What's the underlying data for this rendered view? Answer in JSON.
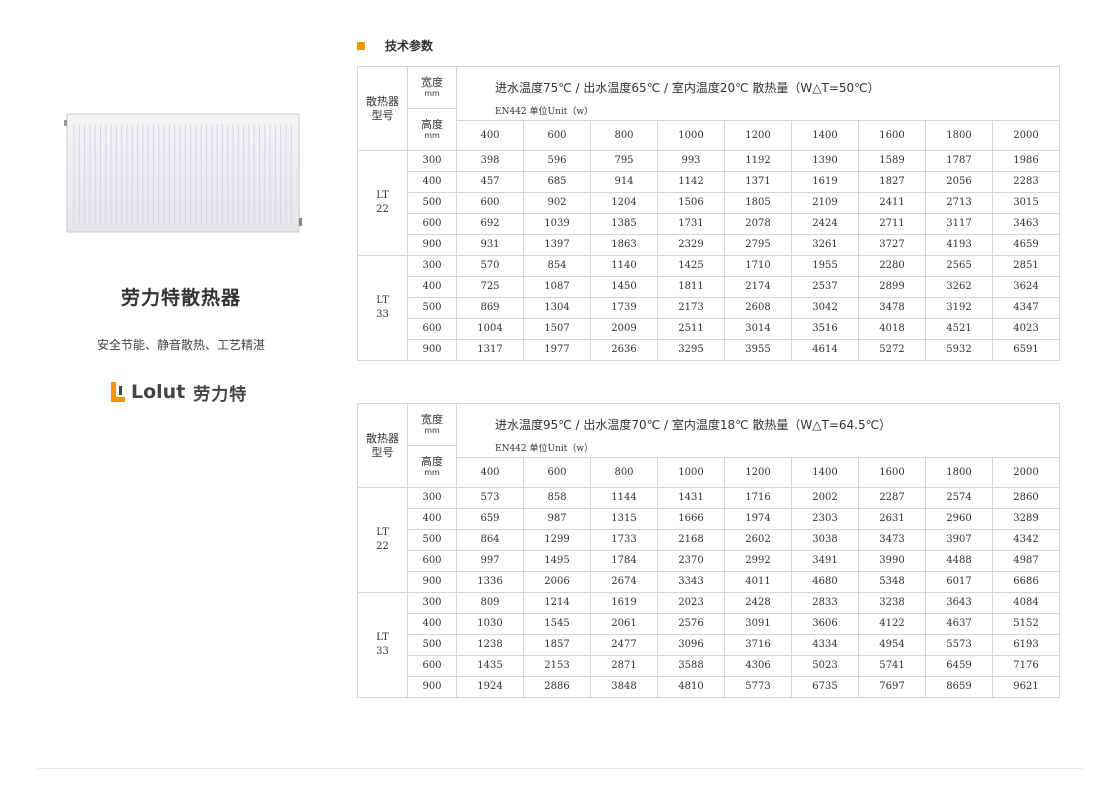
{
  "product": {
    "title": "劳力特散热器",
    "slogan": "安全节能、静音散热、工艺精湛",
    "brand_en": "Lolut",
    "brand_cn": "劳力特"
  },
  "section": {
    "title": "技术参数"
  },
  "table_header": {
    "model_label": "散热器型号",
    "width_label": "宽度",
    "height_label": "高度",
    "unit_label": "mm",
    "standard": "EN442   单位Unit（w）"
  },
  "widths": [
    "400",
    "600",
    "800",
    "1000",
    "1200",
    "1400",
    "1600",
    "1800",
    "2000"
  ],
  "tables": [
    {
      "condition": "进水温度75℃ / 出水温度65℃ / 室内温度20℃ 散热量（W△T=50℃）",
      "groups": [
        {
          "model": "LT\n22",
          "rows": [
            {
              "height": "300",
              "values": [
                "398",
                "596",
                "795",
                "993",
                "1192",
                "1390",
                "1589",
                "1787",
                "1986"
              ]
            },
            {
              "height": "400",
              "values": [
                "457",
                "685",
                "914",
                "1142",
                "1371",
                "1619",
                "1827",
                "2056",
                "2283"
              ]
            },
            {
              "height": "500",
              "values": [
                "600",
                "902",
                "1204",
                "1506",
                "1805",
                "2109",
                "2411",
                "2713",
                "3015"
              ]
            },
            {
              "height": "600",
              "values": [
                "692",
                "1039",
                "1385",
                "1731",
                "2078",
                "2424",
                "2711",
                "3117",
                "3463"
              ]
            },
            {
              "height": "900",
              "values": [
                "931",
                "1397",
                "1863",
                "2329",
                "2795",
                "3261",
                "3727",
                "4193",
                "4659"
              ]
            }
          ]
        },
        {
          "model": "LT\n33",
          "rows": [
            {
              "height": "300",
              "values": [
                "570",
                "854",
                "1140",
                "1425",
                "1710",
                "1955",
                "2280",
                "2565",
                "2851"
              ]
            },
            {
              "height": "400",
              "values": [
                "725",
                "1087",
                "1450",
                "1811",
                "2174",
                "2537",
                "2899",
                "3262",
                "3624"
              ]
            },
            {
              "height": "500",
              "values": [
                "869",
                "1304",
                "1739",
                "2173",
                "2608",
                "3042",
                "3478",
                "3192",
                "4347"
              ]
            },
            {
              "height": "600",
              "values": [
                "1004",
                "1507",
                "2009",
                "2511",
                "3014",
                "3516",
                "4018",
                "4521",
                "4023"
              ]
            },
            {
              "height": "900",
              "values": [
                "1317",
                "1977",
                "2636",
                "3295",
                "3955",
                "4614",
                "5272",
                "5932",
                "6591"
              ]
            }
          ]
        }
      ]
    },
    {
      "condition": "进水温度95℃ / 出水温度70℃ / 室内温度18℃ 散热量（W△T=64.5℃）",
      "groups": [
        {
          "model": "LT\n22",
          "rows": [
            {
              "height": "300",
              "values": [
                "573",
                "858",
                "1144",
                "1431",
                "1716",
                "2002",
                "2287",
                "2574",
                "2860"
              ]
            },
            {
              "height": "400",
              "values": [
                "659",
                "987",
                "1315",
                "1666",
                "1974",
                "2303",
                "2631",
                "2960",
                "3289"
              ]
            },
            {
              "height": "500",
              "values": [
                "864",
                "1299",
                "1733",
                "2168",
                "2602",
                "3038",
                "3473",
                "3907",
                "4342"
              ]
            },
            {
              "height": "600",
              "values": [
                "997",
                "1495",
                "1784",
                "2370",
                "2992",
                "3491",
                "3990",
                "4488",
                "4987"
              ]
            },
            {
              "height": "900",
              "values": [
                "1336",
                "2006",
                "2674",
                "3343",
                "4011",
                "4680",
                "5348",
                "6017",
                "6686"
              ]
            }
          ]
        },
        {
          "model": "LT\n33",
          "rows": [
            {
              "height": "300",
              "values": [
                "809",
                "1214",
                "1619",
                "2023",
                "2428",
                "2833",
                "3238",
                "3643",
                "4084"
              ]
            },
            {
              "height": "400",
              "values": [
                "1030",
                "1545",
                "2061",
                "2576",
                "3091",
                "3606",
                "4122",
                "4637",
                "5152"
              ]
            },
            {
              "height": "500",
              "values": [
                "1238",
                "1857",
                "2477",
                "3096",
                "3716",
                "4334",
                "4954",
                "5573",
                "6193"
              ]
            },
            {
              "height": "600",
              "values": [
                "1435",
                "2153",
                "2871",
                "3588",
                "4306",
                "5023",
                "5741",
                "6459",
                "7176"
              ]
            },
            {
              "height": "900",
              "values": [
                "1924",
                "2886",
                "3848",
                "4810",
                "5773",
                "6735",
                "7697",
                "8659",
                "9621"
              ]
            }
          ]
        }
      ]
    }
  ]
}
